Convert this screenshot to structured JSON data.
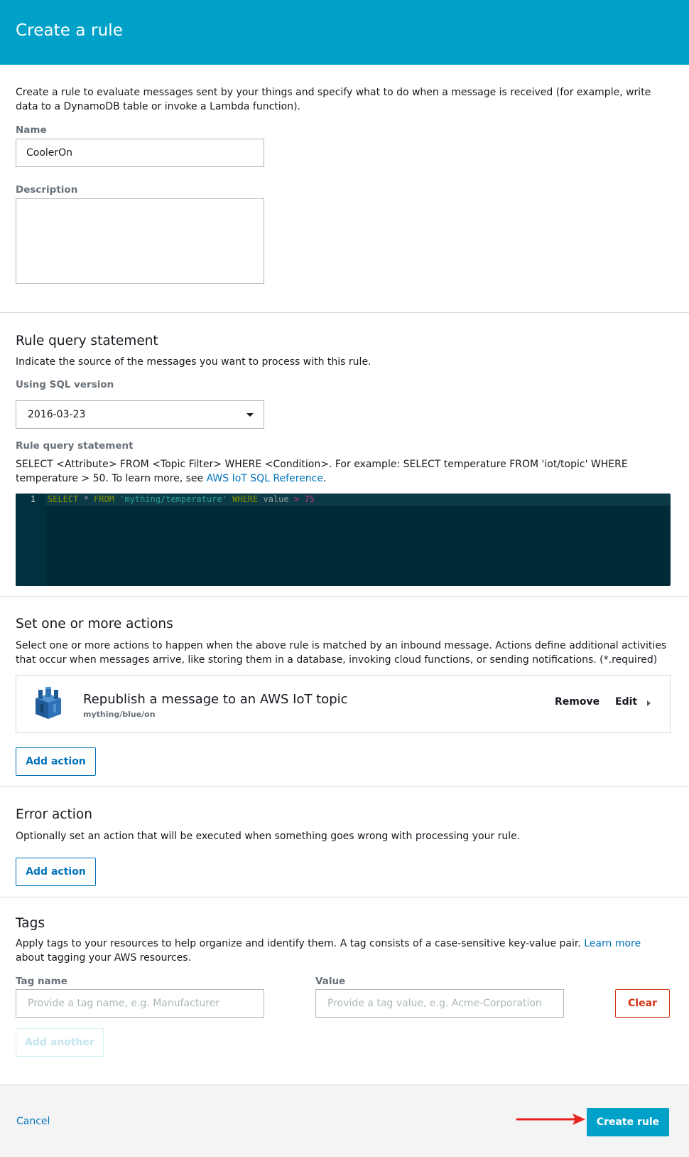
{
  "header": {
    "title": "Create a rule"
  },
  "intro": {
    "text": "Create a rule to evaluate messages sent by your things and specify what to do when a message is received (for example, write data to a DynamoDB table or invoke a Lambda function)."
  },
  "name_field": {
    "label": "Name",
    "value": "CoolerOn"
  },
  "description_field": {
    "label": "Description",
    "value": ""
  },
  "query_section": {
    "title": "Rule query statement",
    "subtitle": "Indicate the source of the messages you want to process with this rule.",
    "sql_version_label": "Using SQL version",
    "sql_version_value": "2016-03-23",
    "statement_label": "Rule query statement",
    "help_text": "SELECT <Attribute> FROM <Topic Filter> WHERE <Condition>. For example: SELECT temperature FROM 'iot/topic' WHERE temperature > 50. To learn more, see ",
    "help_link": "AWS IoT SQL Reference",
    "help_end": "."
  },
  "editor": {
    "line_number": "1",
    "tokens": {
      "select": "SELECT",
      "star": " * ",
      "from": "FROM",
      "topic": " 'mything/temperature' ",
      "where": "WHERE",
      "field": " value ",
      "op": "> ",
      "num": "75"
    }
  },
  "actions_section": {
    "title": "Set one or more actions",
    "text": "Select one or more actions to happen when the above rule is matched by an inbound message. Actions define additional activities that occur when messages arrive, like storing them in a database, invoking cloud functions, or sending notifications. (*.required)",
    "action": {
      "title": "Republish a message to an AWS IoT topic",
      "subtitle": "mything/blue/on",
      "icon": "iot-republish-icon",
      "remove_label": "Remove",
      "edit_label": "Edit"
    },
    "add_label": "Add action"
  },
  "error_section": {
    "title": "Error action",
    "text": "Optionally set an action that will be executed when something goes wrong with processing your rule.",
    "add_label": "Add action"
  },
  "tags_section": {
    "title": "Tags",
    "text_before": "Apply tags to your resources to help organize and identify them. A tag consists of a case-sensitive key-value pair. ",
    "link": "Learn more",
    "text_after": " about tagging your AWS resources.",
    "tag_name_label": "Tag name",
    "tag_name_placeholder": "Provide a tag name, e.g. Manufacturer",
    "value_label": "Value",
    "value_placeholder": "Provide a tag value, e.g. Acme-Corporation",
    "clear_label": "Clear",
    "add_another_label": "Add another"
  },
  "footer": {
    "cancel_label": "Cancel",
    "create_label": "Create rule"
  },
  "colors": {
    "header": "#00a1c9",
    "primary_button": "#00a1c9",
    "link": "#0073bb",
    "danger": "#d13212",
    "editor_bg": "#002b36",
    "annotation_arrow": "#e8221b"
  }
}
